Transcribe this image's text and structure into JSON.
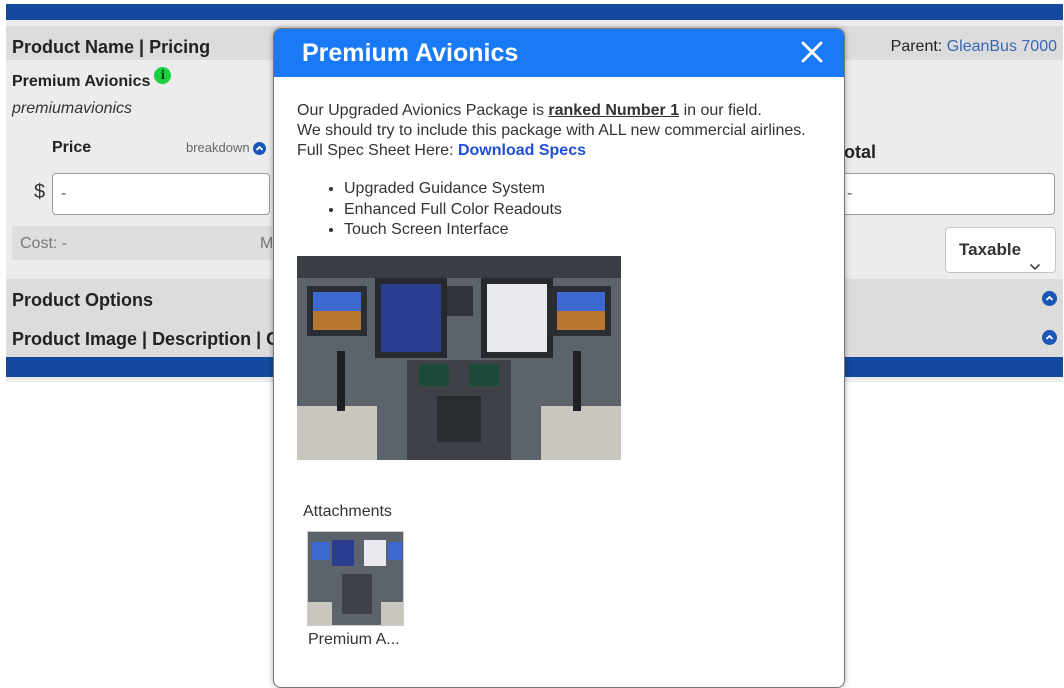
{
  "page": {
    "header_title": "Product Name | Pricing",
    "parent_label": "Parent:",
    "parent_link": "GleanBus 7000",
    "product_name": "Premium Avionics",
    "product_sku": "premiumavionics",
    "price_label": "Price",
    "breakdown_label": "breakdown",
    "currency_symbol": "$",
    "price_value": "-",
    "cost_text": "Cost: -",
    "cost_trailing": "M",
    "total_label": "otal",
    "total_value": "-",
    "taxable_label": "Taxable",
    "section_options": "Product Options",
    "section_image": "Product Image | Description | C"
  },
  "modal": {
    "title": "Premium Avionics",
    "line1_prefix": "Our Upgraded Avionics Package is ",
    "line1_emphasis": "ranked Number 1",
    "line1_suffix": " in our field.",
    "line2": "We should try to include this package with ALL new commercial airlines.",
    "line3_prefix": "Full Spec Sheet Here: ",
    "download_link": "Download Specs",
    "features": [
      "Upgraded Guidance System",
      "Enhanced Full Color Readouts",
      "Touch Screen Interface"
    ],
    "attachments_label": "Attachments",
    "attachment_name": "Premium A..."
  },
  "colors": {
    "topbar": "#13499e",
    "modal_header": "#1a7af5",
    "link": "#3a66b8",
    "download_link": "#1f4fd6",
    "info_icon": "#1ecf3f"
  }
}
